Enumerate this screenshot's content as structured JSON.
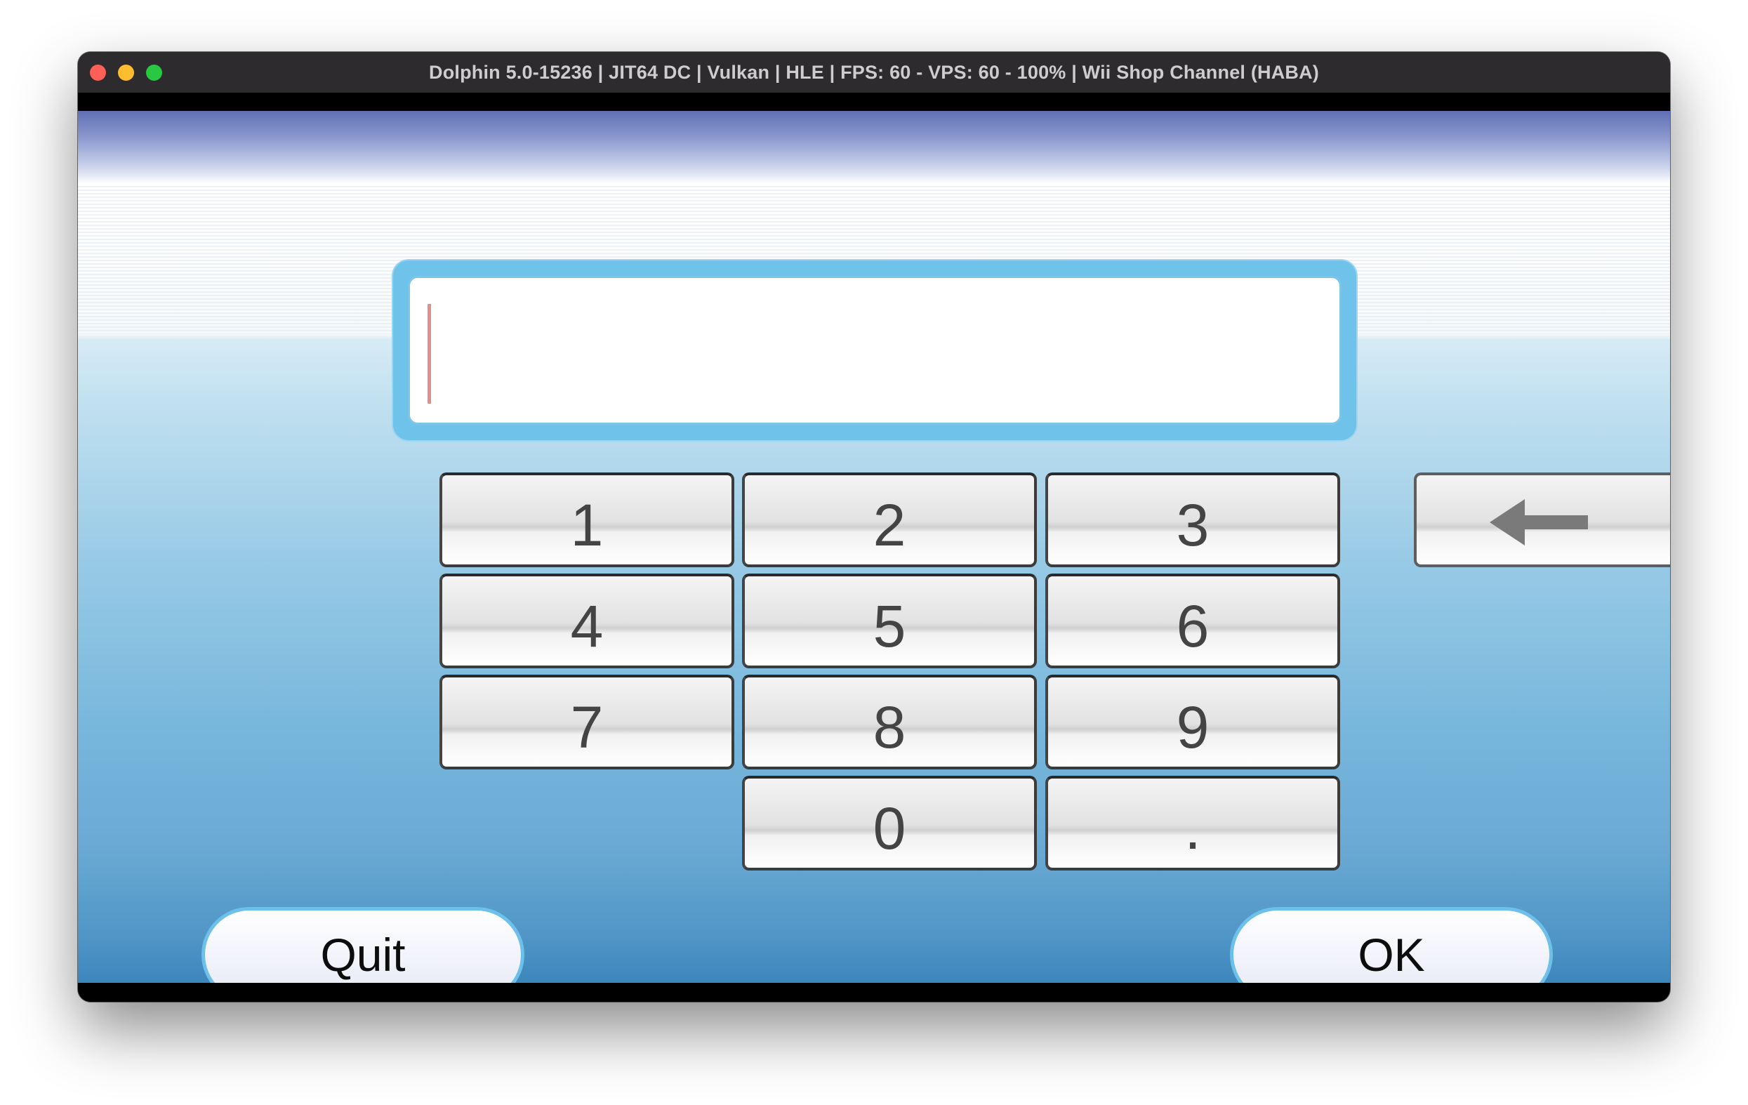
{
  "window": {
    "title": "Dolphin 5.0-15236 | JIT64 DC | Vulkan | HLE | FPS: 60 - VPS: 60 - 100% | Wii Shop Channel (HABA)"
  },
  "traffic_lights": {
    "close_color": "#fe5f57",
    "minimize_color": "#febc2e",
    "maximize_color": "#28c840"
  },
  "input": {
    "value": ""
  },
  "keypad": {
    "keys": [
      "1",
      "2",
      "3",
      "4",
      "5",
      "6",
      "7",
      "8",
      "9",
      "0",
      "."
    ],
    "backspace_icon": "arrow-left-icon"
  },
  "buttons": {
    "quit_label": "Quit",
    "ok_label": "OK"
  },
  "colors": {
    "accent": "#6fc2ea",
    "caret": "#e08f8f",
    "key_text": "#444444"
  }
}
